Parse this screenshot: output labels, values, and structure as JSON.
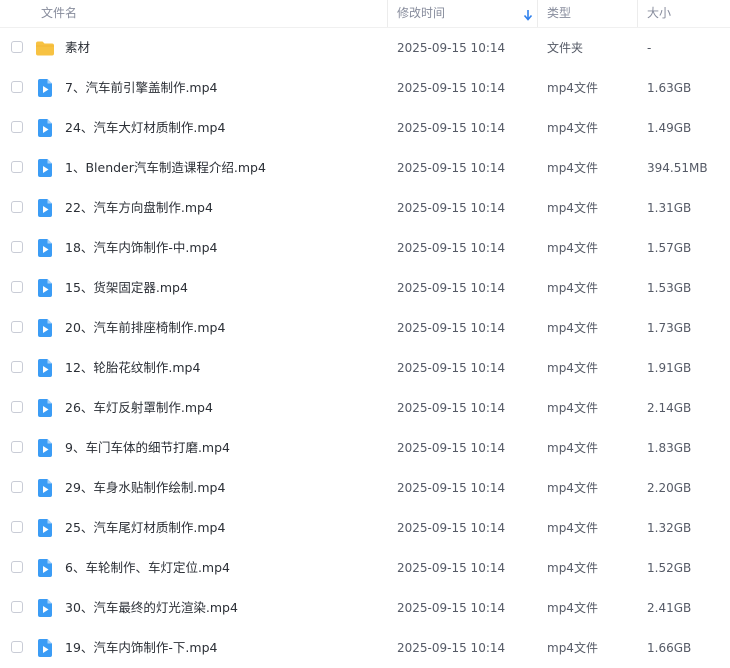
{
  "header": {
    "name": "文件名",
    "modified": "修改时间",
    "type": "类型",
    "size": "大小",
    "sort_icon": "arrow-down-icon",
    "accent": "#2f80ed"
  },
  "colors": {
    "folder": "#f7c242",
    "video": "#3b9cf5"
  },
  "files": [
    {
      "name": "素材",
      "modified": "2025-09-15 10:14",
      "type": "文件夹",
      "size": "-",
      "icon": "folder-icon"
    },
    {
      "name": "7、汽车前引擎盖制作.mp4",
      "modified": "2025-09-15 10:14",
      "type": "mp4文件",
      "size": "1.63GB",
      "icon": "video-icon"
    },
    {
      "name": "24、汽车大灯材质制作.mp4",
      "modified": "2025-09-15 10:14",
      "type": "mp4文件",
      "size": "1.49GB",
      "icon": "video-icon"
    },
    {
      "name": "1、Blender汽车制造课程介绍.mp4",
      "modified": "2025-09-15 10:14",
      "type": "mp4文件",
      "size": "394.51MB",
      "icon": "video-icon"
    },
    {
      "name": "22、汽车方向盘制作.mp4",
      "modified": "2025-09-15 10:14",
      "type": "mp4文件",
      "size": "1.31GB",
      "icon": "video-icon"
    },
    {
      "name": "18、汽车内饰制作-中.mp4",
      "modified": "2025-09-15 10:14",
      "type": "mp4文件",
      "size": "1.57GB",
      "icon": "video-icon"
    },
    {
      "name": "15、货架固定器.mp4",
      "modified": "2025-09-15 10:14",
      "type": "mp4文件",
      "size": "1.53GB",
      "icon": "video-icon"
    },
    {
      "name": "20、汽车前排座椅制作.mp4",
      "modified": "2025-09-15 10:14",
      "type": "mp4文件",
      "size": "1.73GB",
      "icon": "video-icon"
    },
    {
      "name": "12、轮胎花纹制作.mp4",
      "modified": "2025-09-15 10:14",
      "type": "mp4文件",
      "size": "1.91GB",
      "icon": "video-icon"
    },
    {
      "name": "26、车灯反射罩制作.mp4",
      "modified": "2025-09-15 10:14",
      "type": "mp4文件",
      "size": "2.14GB",
      "icon": "video-icon"
    },
    {
      "name": "9、车门车体的细节打磨.mp4",
      "modified": "2025-09-15 10:14",
      "type": "mp4文件",
      "size": "1.83GB",
      "icon": "video-icon"
    },
    {
      "name": "29、车身水贴制作绘制.mp4",
      "modified": "2025-09-15 10:14",
      "type": "mp4文件",
      "size": "2.20GB",
      "icon": "video-icon"
    },
    {
      "name": "25、汽车尾灯材质制作.mp4",
      "modified": "2025-09-15 10:14",
      "type": "mp4文件",
      "size": "1.32GB",
      "icon": "video-icon"
    },
    {
      "name": "6、车轮制作、车灯定位.mp4",
      "modified": "2025-09-15 10:14",
      "type": "mp4文件",
      "size": "1.52GB",
      "icon": "video-icon"
    },
    {
      "name": "30、汽车最终的灯光渲染.mp4",
      "modified": "2025-09-15 10:14",
      "type": "mp4文件",
      "size": "2.41GB",
      "icon": "video-icon"
    },
    {
      "name": "19、汽车内饰制作-下.mp4",
      "modified": "2025-09-15 10:14",
      "type": "mp4文件",
      "size": "1.66GB",
      "icon": "video-icon"
    }
  ]
}
